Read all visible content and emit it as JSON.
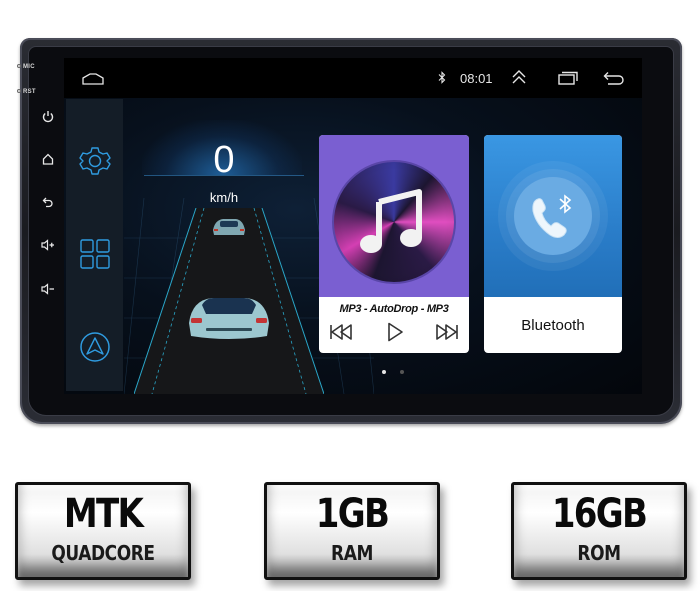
{
  "device": {
    "side_labels": {
      "mic": "MIC",
      "rst": "RST"
    },
    "hardware_buttons": [
      {
        "name": "power",
        "icon": "power-icon"
      },
      {
        "name": "home",
        "icon": "home-icon"
      },
      {
        "name": "back",
        "icon": "back-icon"
      },
      {
        "name": "volume-up",
        "icon": "volume-up-icon"
      },
      {
        "name": "volume-down",
        "icon": "volume-down-icon"
      }
    ]
  },
  "statusbar": {
    "home_icon": "home-outline-icon",
    "bluetooth_icon": "bluetooth-icon",
    "time": "08:01",
    "expand_icon": "double-chevron-up-icon",
    "recents_icon": "recent-apps-icon",
    "back_icon": "back-arrow-icon"
  },
  "dock": {
    "items": [
      {
        "name": "settings",
        "icon": "gear-icon"
      },
      {
        "name": "apps",
        "icon": "app-grid-icon"
      },
      {
        "name": "navigation",
        "icon": "navigation-arrow-icon"
      }
    ]
  },
  "speedometer": {
    "value": "0",
    "unit": "km/h"
  },
  "cards": {
    "music": {
      "title": "MP3 - AutoDrop - MP3",
      "bg_color": "#7a5fd1",
      "controls": [
        "previous-icon",
        "play-icon",
        "next-icon"
      ]
    },
    "bluetooth": {
      "label": "Bluetooth",
      "bg_color": "#2a7dc9"
    }
  },
  "pager": {
    "pages": 2,
    "active": 1
  },
  "badges": [
    {
      "main": "MTK",
      "sub": "QUADCORE"
    },
    {
      "main": "1GB",
      "sub": "RAM"
    },
    {
      "main": "16GB",
      "sub": "ROM"
    }
  ]
}
